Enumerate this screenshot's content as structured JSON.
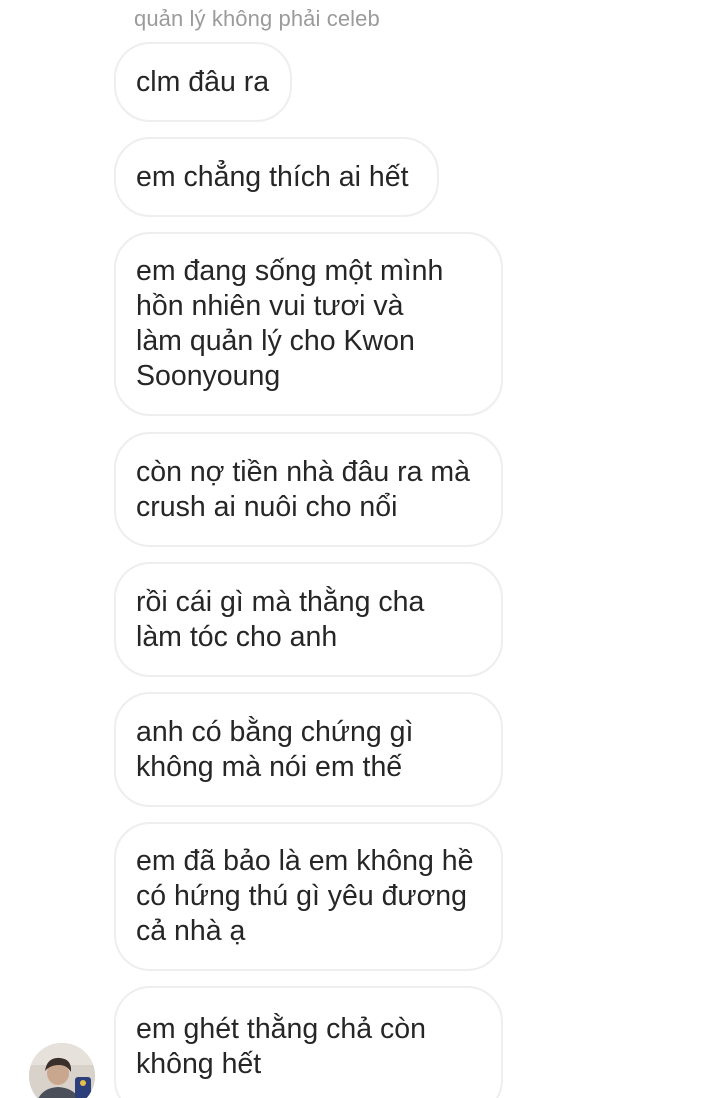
{
  "thread": {
    "sender_label": "quản lý không phải celeb",
    "messages": [
      {
        "text": "clm đâu ra"
      },
      {
        "text": "em chẳng thích ai hết"
      },
      {
        "text": "em đang sống một mình\nhồn nhiên vui tươi và\nlàm quản lý cho Kwon\nSoonyoung"
      },
      {
        "text": "còn nợ tiền nhà đâu ra mà\ncrush ai nuôi cho nổi"
      },
      {
        "text": "rồi cái gì mà thằng cha\nlàm tóc cho anh"
      },
      {
        "text": "anh có bằng chứng gì\nkhông mà nói em thế"
      },
      {
        "text": "em đã bảo là em không hề\ncó hứng thú gì yêu đương\ncả nhà ạ"
      },
      {
        "text": "em ghét thằng chả còn\nkhông hết"
      }
    ],
    "avatar": {
      "icon": "user-avatar-photo"
    }
  },
  "colors": {
    "background": "#ffffff",
    "bubble_border": "#eeeeee",
    "message_text": "#262626",
    "sender_label": "#9b9b9b"
  }
}
